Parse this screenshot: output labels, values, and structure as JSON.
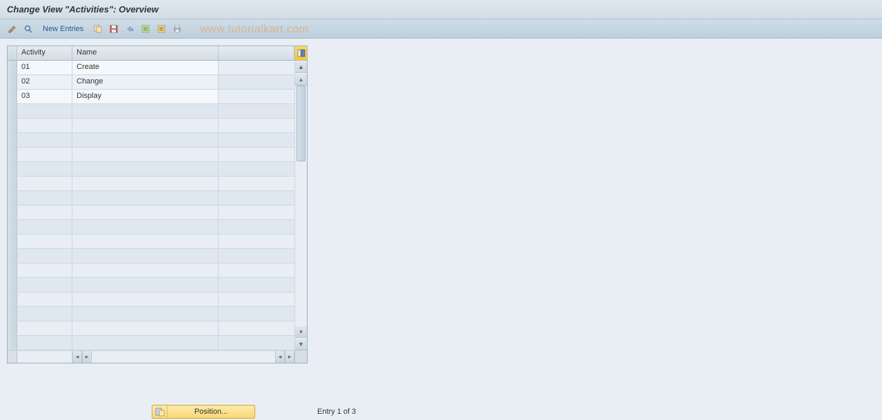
{
  "title": "Change View \"Activities\": Overview",
  "toolbar": {
    "new_entries": "New Entries"
  },
  "watermark": "www.tutorialkart.com",
  "table": {
    "headers": {
      "activity": "Activity",
      "name": "Name"
    },
    "rows": [
      {
        "activity": "01",
        "name": "Create"
      },
      {
        "activity": "02",
        "name": "Change"
      },
      {
        "activity": "03",
        "name": "Display"
      }
    ]
  },
  "footer": {
    "position_label": "Position...",
    "entry_status": "Entry 1 of 3"
  }
}
